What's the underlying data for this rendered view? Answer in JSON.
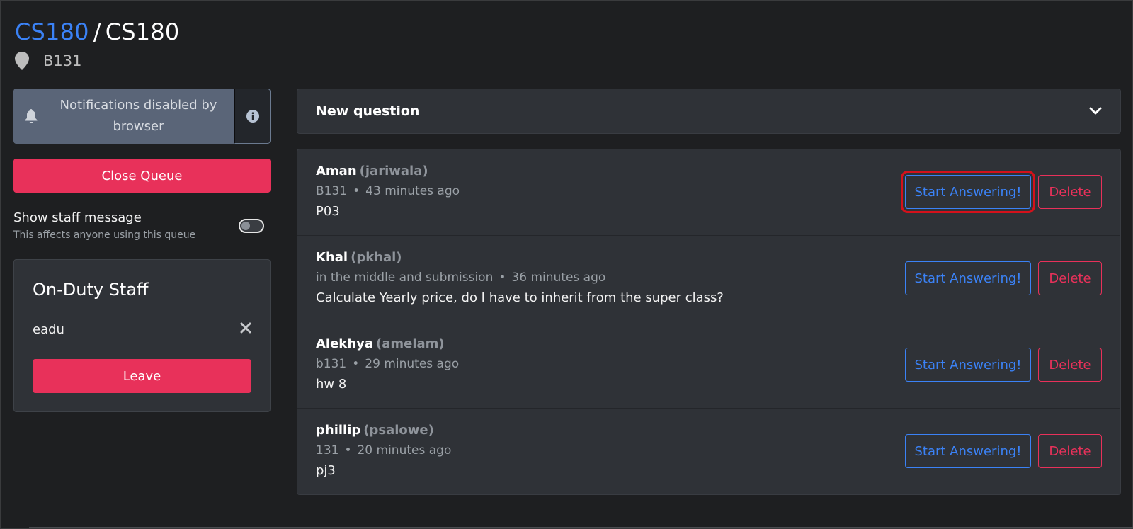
{
  "breadcrumb": {
    "course": "CS180",
    "separator": "/",
    "queue": "CS180"
  },
  "location": "B131",
  "notifications": {
    "message": "Notifications disabled by browser"
  },
  "close_queue_label": "Close Queue",
  "staff_message": {
    "title": "Show staff message",
    "subtitle": "This affects anyone using this queue",
    "enabled": false
  },
  "on_duty": {
    "title": "On-Duty Staff",
    "staff": [
      "eadu"
    ],
    "leave_label": "Leave"
  },
  "new_question": {
    "title": "New question"
  },
  "questions": [
    {
      "name": "Aman",
      "username": "(jariwala)",
      "location": "B131",
      "time": "43 minutes ago",
      "text": "P03"
    },
    {
      "name": "Khai",
      "username": "(pkhai)",
      "location": "in the middle and submission",
      "time": "36 minutes ago",
      "text": "Calculate Yearly price, do I have to inherit from the super class?"
    },
    {
      "name": "Alekhya",
      "username": "(amelam)",
      "location": "b131",
      "time": "29 minutes ago",
      "text": "hw 8"
    },
    {
      "name": "phillip",
      "username": "(psalowe)",
      "location": "131",
      "time": "20 minutes ago",
      "text": "pj3"
    }
  ],
  "actions": {
    "answer_label": "Start Answering!",
    "delete_label": "Delete",
    "meta_separator": "•"
  },
  "colors": {
    "accent_blue": "#3b82f6",
    "danger_red": "#e8315a",
    "background": "#1e1f21",
    "card": "#2f3237"
  }
}
